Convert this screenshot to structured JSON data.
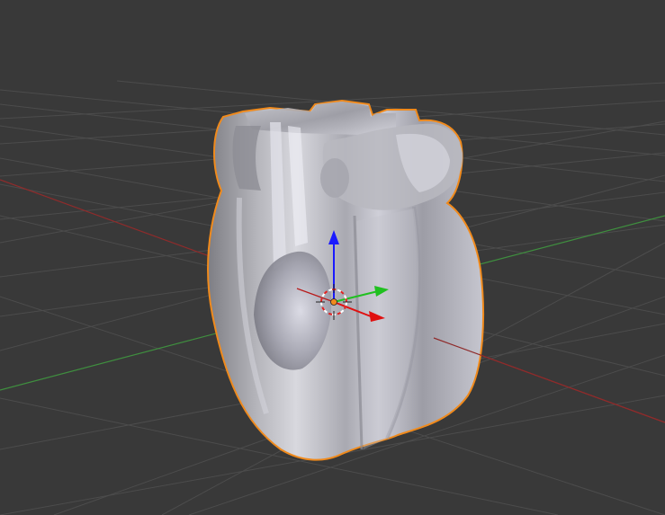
{
  "viewport": {
    "background": "#393939",
    "grid_color": "#4c4c4c",
    "x_axis_color": "#8f2b2b",
    "y_axis_color": "#3f8f3f",
    "selection_outline_color": "#f08a1c",
    "object_state": "selected"
  },
  "gizmo": {
    "z_color": "#1a1aff",
    "y_color": "#20c020",
    "x_color": "#e01010",
    "origin_color": "#f08a1c",
    "cursor_icon": "3d-cursor-icon"
  }
}
